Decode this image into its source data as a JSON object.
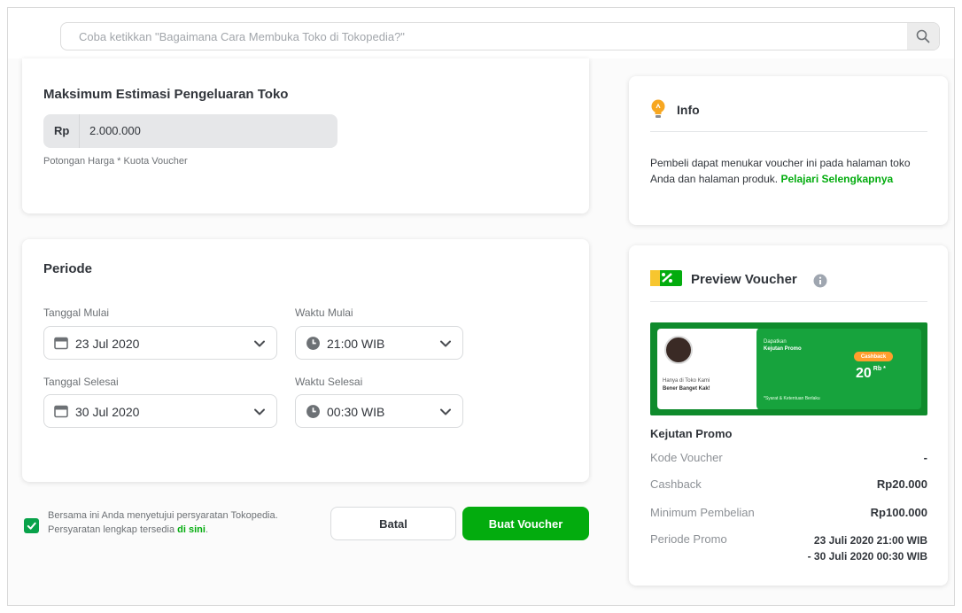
{
  "search": {
    "placeholder": "Coba ketikkan \"Bagaimana Cara Membuka Toko di Tokopedia?\"",
    "button_icon": "search-icon"
  },
  "budget": {
    "title": "Maksimum Estimasi Pengeluaran Toko",
    "currency": "Rp",
    "value": "2.000.000",
    "hint": "Potongan Harga * Kuota Voucher"
  },
  "period": {
    "title": "Periode",
    "start_date_label": "Tanggal Mulai",
    "start_date": "23 Jul 2020",
    "start_time_label": "Waktu Mulai",
    "start_time": "21:00 WIB",
    "end_date_label": "Tanggal Selesai",
    "end_date": "30 Jul 2020",
    "end_time_label": "Waktu Selesai",
    "end_time": "00:30 WIB"
  },
  "terms": {
    "line1": "Bersama ini Anda menyetujui persyaratan Tokopedia.",
    "line2_prefix": "Persyaratan lengkap tersedia",
    "line2_link": "di sini",
    "line2_suffix": ".",
    "checked": true
  },
  "actions": {
    "cancel": "Batal",
    "create": "Buat Voucher"
  },
  "info": {
    "title": "Info",
    "text": "Pembeli dapat menukar voucher ini pada halaman toko Anda dan halaman produk.",
    "link": "Pelajari Selengkapnya"
  },
  "preview": {
    "title": "Preview Voucher",
    "banner": {
      "small_left_1": "Hanya di Toko Kami",
      "small_left_2": "Bener Banget Kak!",
      "small_right_1": "Dapatkan",
      "small_right_2": "Kejutan Promo",
      "pill": "Cashback",
      "amount": "20",
      "amount_suffix": "Rb *",
      "footnote": "*Syarat & Ketentuan Berlaku"
    },
    "name": "Kejutan Promo",
    "rows": [
      {
        "key": "Kode Voucher",
        "value": "-"
      },
      {
        "key": "Cashback",
        "value": "Rp20.000"
      },
      {
        "key": "Minimum Pembelian",
        "value": "Rp100.000"
      }
    ],
    "period_key": "Periode Promo",
    "period_line1": "23 Juli 2020 21:00 WIB",
    "period_line2": "- 30 Juli 2020 00:30 WIB"
  },
  "colors": {
    "primary_green": "#03ac0e",
    "checkbox_green": "#09a24a",
    "info_icon": "#f7a721"
  }
}
